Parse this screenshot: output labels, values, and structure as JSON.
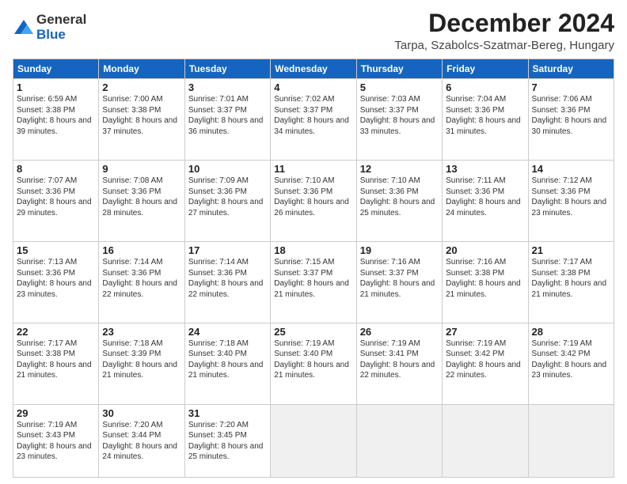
{
  "logo": {
    "general": "General",
    "blue": "Blue"
  },
  "title": "December 2024",
  "subtitle": "Tarpa, Szabolcs-Szatmar-Bereg, Hungary",
  "headers": [
    "Sunday",
    "Monday",
    "Tuesday",
    "Wednesday",
    "Thursday",
    "Friday",
    "Saturday"
  ],
  "weeks": [
    [
      {
        "day": "1",
        "sunrise": "6:59 AM",
        "sunset": "3:38 PM",
        "daylight": "8 hours and 39 minutes."
      },
      {
        "day": "2",
        "sunrise": "7:00 AM",
        "sunset": "3:38 PM",
        "daylight": "8 hours and 37 minutes."
      },
      {
        "day": "3",
        "sunrise": "7:01 AM",
        "sunset": "3:37 PM",
        "daylight": "8 hours and 36 minutes."
      },
      {
        "day": "4",
        "sunrise": "7:02 AM",
        "sunset": "3:37 PM",
        "daylight": "8 hours and 34 minutes."
      },
      {
        "day": "5",
        "sunrise": "7:03 AM",
        "sunset": "3:37 PM",
        "daylight": "8 hours and 33 minutes."
      },
      {
        "day": "6",
        "sunrise": "7:04 AM",
        "sunset": "3:36 PM",
        "daylight": "8 hours and 31 minutes."
      },
      {
        "day": "7",
        "sunrise": "7:06 AM",
        "sunset": "3:36 PM",
        "daylight": "8 hours and 30 minutes."
      }
    ],
    [
      {
        "day": "8",
        "sunrise": "7:07 AM",
        "sunset": "3:36 PM",
        "daylight": "8 hours and 29 minutes."
      },
      {
        "day": "9",
        "sunrise": "7:08 AM",
        "sunset": "3:36 PM",
        "daylight": "8 hours and 28 minutes."
      },
      {
        "day": "10",
        "sunrise": "7:09 AM",
        "sunset": "3:36 PM",
        "daylight": "8 hours and 27 minutes."
      },
      {
        "day": "11",
        "sunrise": "7:10 AM",
        "sunset": "3:36 PM",
        "daylight": "8 hours and 26 minutes."
      },
      {
        "day": "12",
        "sunrise": "7:10 AM",
        "sunset": "3:36 PM",
        "daylight": "8 hours and 25 minutes."
      },
      {
        "day": "13",
        "sunrise": "7:11 AM",
        "sunset": "3:36 PM",
        "daylight": "8 hours and 24 minutes."
      },
      {
        "day": "14",
        "sunrise": "7:12 AM",
        "sunset": "3:36 PM",
        "daylight": "8 hours and 23 minutes."
      }
    ],
    [
      {
        "day": "15",
        "sunrise": "7:13 AM",
        "sunset": "3:36 PM",
        "daylight": "8 hours and 23 minutes."
      },
      {
        "day": "16",
        "sunrise": "7:14 AM",
        "sunset": "3:36 PM",
        "daylight": "8 hours and 22 minutes."
      },
      {
        "day": "17",
        "sunrise": "7:14 AM",
        "sunset": "3:36 PM",
        "daylight": "8 hours and 22 minutes."
      },
      {
        "day": "18",
        "sunrise": "7:15 AM",
        "sunset": "3:37 PM",
        "daylight": "8 hours and 21 minutes."
      },
      {
        "day": "19",
        "sunrise": "7:16 AM",
        "sunset": "3:37 PM",
        "daylight": "8 hours and 21 minutes."
      },
      {
        "day": "20",
        "sunrise": "7:16 AM",
        "sunset": "3:38 PM",
        "daylight": "8 hours and 21 minutes."
      },
      {
        "day": "21",
        "sunrise": "7:17 AM",
        "sunset": "3:38 PM",
        "daylight": "8 hours and 21 minutes."
      }
    ],
    [
      {
        "day": "22",
        "sunrise": "7:17 AM",
        "sunset": "3:38 PM",
        "daylight": "8 hours and 21 minutes."
      },
      {
        "day": "23",
        "sunrise": "7:18 AM",
        "sunset": "3:39 PM",
        "daylight": "8 hours and 21 minutes."
      },
      {
        "day": "24",
        "sunrise": "7:18 AM",
        "sunset": "3:40 PM",
        "daylight": "8 hours and 21 minutes."
      },
      {
        "day": "25",
        "sunrise": "7:19 AM",
        "sunset": "3:40 PM",
        "daylight": "8 hours and 21 minutes."
      },
      {
        "day": "26",
        "sunrise": "7:19 AM",
        "sunset": "3:41 PM",
        "daylight": "8 hours and 22 minutes."
      },
      {
        "day": "27",
        "sunrise": "7:19 AM",
        "sunset": "3:42 PM",
        "daylight": "8 hours and 22 minutes."
      },
      {
        "day": "28",
        "sunrise": "7:19 AM",
        "sunset": "3:42 PM",
        "daylight": "8 hours and 23 minutes."
      }
    ],
    [
      {
        "day": "29",
        "sunrise": "7:19 AM",
        "sunset": "3:43 PM",
        "daylight": "8 hours and 23 minutes."
      },
      {
        "day": "30",
        "sunrise": "7:20 AM",
        "sunset": "3:44 PM",
        "daylight": "8 hours and 24 minutes."
      },
      {
        "day": "31",
        "sunrise": "7:20 AM",
        "sunset": "3:45 PM",
        "daylight": "8 hours and 25 minutes."
      },
      null,
      null,
      null,
      null
    ]
  ]
}
